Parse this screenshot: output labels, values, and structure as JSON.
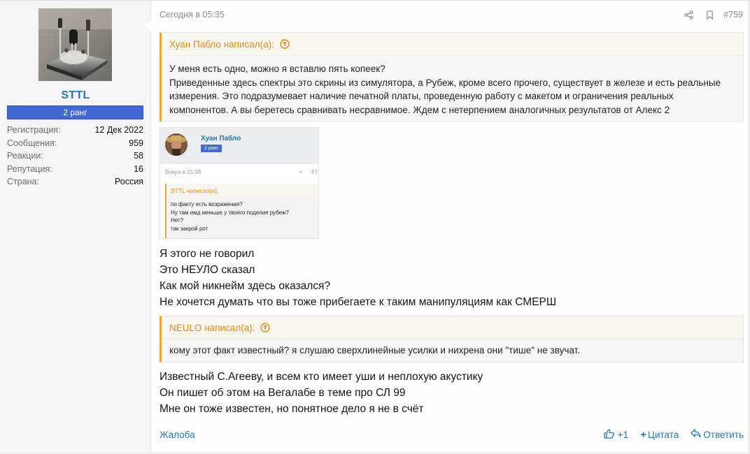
{
  "user": {
    "name": "STTL",
    "rank": "2 ранг",
    "stats": [
      {
        "label": "Регистрация:",
        "value": "12 Дек 2022"
      },
      {
        "label": "Сообщения:",
        "value": "959"
      },
      {
        "label": "Реакции:",
        "value": "58"
      },
      {
        "label": "Репутация:",
        "value": "16"
      },
      {
        "label": "Страна:",
        "value": "Россия"
      }
    ]
  },
  "post": {
    "date": "Сегодня в 05:35",
    "number": "#759",
    "quote1": {
      "author": "Хуан Пабло написал(а):",
      "lines": [
        "У меня есть одно, можно я вставлю пять копеек?",
        "Приведенные здесь спектры это скрины из симулятора, а Рубеж, кроме всего прочего, существует в железе и есть реальные",
        "измерения. Это подразумевает наличие печатной платы, проведенную работу с макетом и ограничения реальных",
        "компонентов. А вы беретесь сравнивать несравнимое. Ждем с нетерпением аналогичных результатов от Алекс 2"
      ]
    },
    "embed": {
      "name": "Хуан Пабло",
      "rank": "2 ранг",
      "date": "Вчера в 21:58",
      "number": "#7",
      "quote_author": "STTL написал(а):",
      "quote_lines": [
        "по факту есть возражения?",
        "Ну там имд меньше у твоего поделия рубеж?",
        "Нет?",
        "так закрой рот"
      ]
    },
    "text1": [
      "Я этого не говорил",
      "Это НЕУЛО сказал",
      "Как мой никнейм здесь оказался?",
      "Не хочется думать что вы тоже прибегаете к таким манипуляциям как СМЕРШ"
    ],
    "quote2": {
      "author": "NEULO написал(а):",
      "lines": [
        "кому этот факт известный? я слушаю сверхлинейные усилки и нихрена они \"тише\" не звучат."
      ]
    },
    "text2": [
      "Известный С.Агееву, и всем кто имеет уши и неплохую акустику",
      "Он пишет об этом на Вегалабе в теме про СЛ 99",
      "Мне он тоже известен, но понятное дело я не в счёт"
    ],
    "footer": {
      "report": "Жалоба",
      "likes": "+1",
      "quote": "Цитата",
      "reply": "Ответить"
    }
  },
  "colors": {
    "link": "#2577b1",
    "rank_bg": "#4269d1",
    "quote_accent": "#f6a32e",
    "quote_author": "#e08a1c"
  },
  "icons": {
    "share": "share-icon",
    "bookmark": "bookmark-icon",
    "quote_up": "arrow-up-circle-icon",
    "like": "thumbs-up-icon",
    "quote_btn": "plus-icon",
    "reply": "reply-icon"
  }
}
